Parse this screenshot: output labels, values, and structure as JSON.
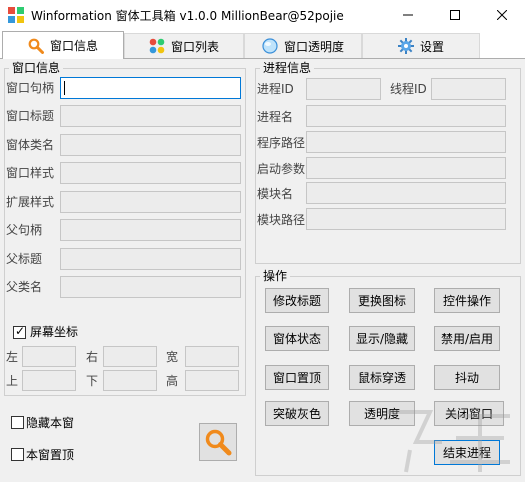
{
  "window": {
    "title": "Winformation 窗体工具箱 v1.0.0  MillionBear@52pojie"
  },
  "tabs": [
    {
      "label": "窗口信息",
      "icon": "search-icon",
      "active": true
    },
    {
      "label": "窗口列表",
      "icon": "grid-icon",
      "active": false
    },
    {
      "label": "窗口透明度",
      "icon": "globe-icon",
      "active": false
    },
    {
      "label": "设置",
      "icon": "gear-icon",
      "active": false
    }
  ],
  "window_info": {
    "title": "窗口信息",
    "fields": [
      {
        "label": "窗口句柄",
        "value": ""
      },
      {
        "label": "窗口标题",
        "value": ""
      },
      {
        "label": "窗体类名",
        "value": ""
      },
      {
        "label": "窗口样式",
        "value": ""
      },
      {
        "label": "扩展样式",
        "value": ""
      },
      {
        "label": "父句柄",
        "value": ""
      },
      {
        "label": "父标题",
        "value": ""
      },
      {
        "label": "父类名",
        "value": ""
      }
    ],
    "screen_coords": {
      "label": "屏幕坐标",
      "checked": true,
      "left": "左",
      "right": "右",
      "width": "宽",
      "top": "上",
      "bottom": "下",
      "height": "高"
    }
  },
  "options": {
    "hide_self": {
      "label": "隐藏本窗",
      "checked": false
    },
    "topmost_self": {
      "label": "本窗置顶",
      "checked": false
    }
  },
  "process_info": {
    "title": "进程信息",
    "pid_label": "进程ID",
    "tid_label": "线程ID",
    "fields": [
      {
        "label": "进程名",
        "value": ""
      },
      {
        "label": "程序路径",
        "value": ""
      },
      {
        "label": "启动参数",
        "value": ""
      },
      {
        "label": "模块名",
        "value": ""
      },
      {
        "label": "模块路径",
        "value": ""
      }
    ]
  },
  "operations": {
    "title": "操作",
    "buttons": [
      "修改标题",
      "更换图标",
      "控件操作",
      "窗体状态",
      "显示/隐藏",
      "禁用/启用",
      "窗口置顶",
      "鼠标穿透",
      "抖动",
      "突破灰色",
      "透明度",
      "关闭窗口",
      "结束进程"
    ]
  },
  "colors": {
    "accent": "#0078d7",
    "search_icon": "#f08a1c",
    "panel_bg": "#f0f0f0"
  }
}
